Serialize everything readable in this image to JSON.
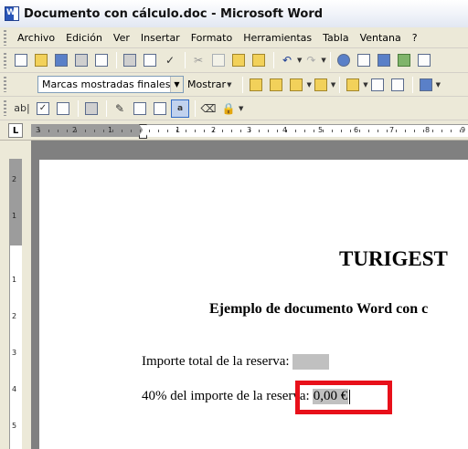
{
  "window": {
    "title": "Documento con cálculo.doc - Microsoft Word"
  },
  "menubar": {
    "items": [
      "Archivo",
      "Edición",
      "Ver",
      "Insertar",
      "Formato",
      "Herramientas",
      "Tabla",
      "Ventana",
      "?"
    ]
  },
  "toolbar_standard": {
    "icons": [
      "new-icon",
      "open-icon",
      "save-icon",
      "permission-icon",
      "email-icon",
      "print-icon",
      "print-preview-icon",
      "spelling-icon",
      "cut-icon",
      "copy-icon",
      "paste-icon",
      "format-painter-icon",
      "undo-icon",
      "redo-icon",
      "hyperlink-icon",
      "tables-borders-icon",
      "insert-table-icon",
      "insert-excel-icon",
      "columns-icon"
    ]
  },
  "toolbar_reviewing": {
    "display_for_review": "Marcas mostradas finales",
    "show_label": "Mostrar"
  },
  "toolbar_forms": {
    "text_field_label": "ab|"
  },
  "ruler": {
    "tab_selector": "L",
    "h_numbers": [
      "3",
      "2",
      "1",
      "1",
      "2",
      "3",
      "4",
      "5",
      "6",
      "7",
      "8",
      "9"
    ],
    "v_numbers": [
      "2",
      "1",
      "1",
      "2",
      "3",
      "4",
      "5"
    ]
  },
  "document": {
    "title": "TURIGEST",
    "subtitle": "Ejemplo de documento Word con c",
    "line1_label": "Importe total de la reserva:",
    "line2_label": "40% del importe de la reserva:",
    "line2_value": "0,00 €"
  },
  "colors": {
    "highlight": "#e8101a",
    "field_shading": "#c0c0c0"
  }
}
